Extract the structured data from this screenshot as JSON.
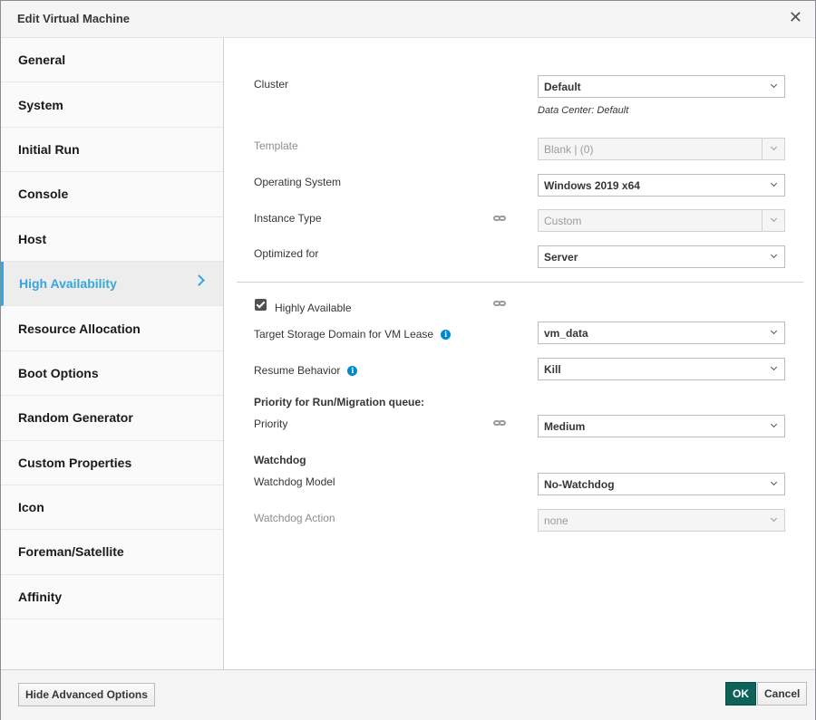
{
  "dialog": {
    "title": "Edit Virtual Machine",
    "close_symbol": "✕"
  },
  "sidebar": {
    "items": [
      {
        "label": "General"
      },
      {
        "label": "System"
      },
      {
        "label": "Initial Run"
      },
      {
        "label": "Console"
      },
      {
        "label": "Host"
      },
      {
        "label": "High Availability",
        "active": true
      },
      {
        "label": "Resource Allocation"
      },
      {
        "label": "Boot Options"
      },
      {
        "label": "Random Generator"
      },
      {
        "label": "Custom Properties"
      },
      {
        "label": "Icon"
      },
      {
        "label": "Foreman/Satellite"
      },
      {
        "label": "Affinity"
      }
    ]
  },
  "form": {
    "cluster": {
      "label": "Cluster",
      "value": "Default",
      "hint": "Data Center: Default"
    },
    "template": {
      "label": "Template",
      "value": "Blank |  (0)"
    },
    "os": {
      "label": "Operating System",
      "value": "Windows 2019 x64"
    },
    "instance_type": {
      "label": "Instance Type",
      "value": "Custom"
    },
    "optimized_for": {
      "label": "Optimized for",
      "value": "Server"
    },
    "highly_available": {
      "label": "Highly Available",
      "checked": true
    },
    "lease_domain": {
      "label": "Target Storage Domain for VM Lease",
      "value": "vm_data"
    },
    "resume_behavior": {
      "label": "Resume Behavior",
      "value": "Kill"
    },
    "priority_section": "Priority for Run/Migration queue:",
    "priority": {
      "label": "Priority",
      "value": "Medium"
    },
    "watchdog_section": "Watchdog",
    "watchdog_model": {
      "label": "Watchdog Model",
      "value": "No-Watchdog"
    },
    "watchdog_action": {
      "label": "Watchdog Action",
      "value": "none"
    }
  },
  "footer": {
    "advanced_label": "Hide Advanced Options",
    "ok_label": "OK",
    "cancel_label": "Cancel"
  },
  "colors": {
    "accent": "#39a5dc",
    "primary_button": "#0e6359",
    "info_icon": "#0088ce"
  },
  "icons": {
    "close": "close-icon",
    "chevron": "chevron-right-icon",
    "link": "link-icon",
    "info": "info-icon"
  }
}
